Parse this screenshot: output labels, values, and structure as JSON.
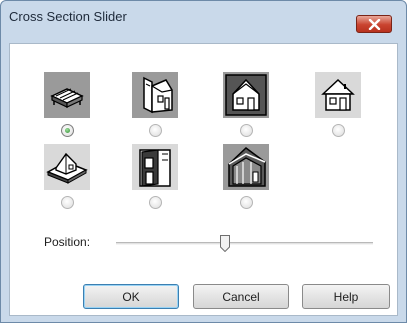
{
  "window": {
    "title": "Cross Section Slider"
  },
  "options": [
    {
      "icon": "floor-slab-icon",
      "checked": true
    },
    {
      "icon": "house-side-section-icon",
      "checked": false
    },
    {
      "icon": "house-front-section-icon",
      "checked": false
    },
    {
      "icon": "house-outline-icon",
      "checked": false
    },
    {
      "icon": "house-floor-plan-icon",
      "checked": false
    },
    {
      "icon": "house-wall-section-icon",
      "checked": false
    },
    {
      "icon": "house-interior-section-icon",
      "checked": false
    }
  ],
  "position": {
    "label": "Position:",
    "value_fraction": 0.4
  },
  "buttons": {
    "ok": "OK",
    "cancel": "Cancel",
    "help": "Help"
  },
  "colors": {
    "frame": "#c9d9ea",
    "close": "#c9432f",
    "radio_selected": "#2f8a2f"
  }
}
